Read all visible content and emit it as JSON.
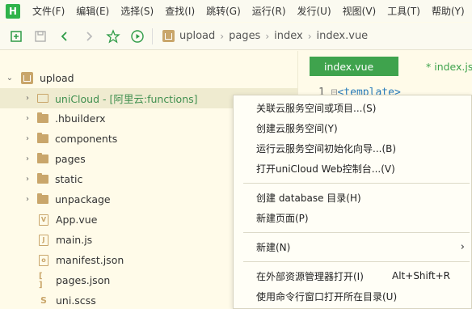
{
  "menubar": {
    "logo": "H",
    "items": [
      "文件(F)",
      "编辑(E)",
      "选择(S)",
      "查找(I)",
      "跳转(G)",
      "运行(R)",
      "发行(U)",
      "视图(V)",
      "工具(T)",
      "帮助(Y)"
    ]
  },
  "toolbar": {
    "breadcrumb": [
      "upload",
      "pages",
      "index",
      "index.vue"
    ]
  },
  "tree": {
    "project": "upload",
    "rows": [
      {
        "label": "uniCloud - [阿里云:functions]",
        "kind": "cloud",
        "expandable": true
      },
      {
        "label": ".hbuilderx",
        "kind": "folder",
        "expandable": true
      },
      {
        "label": "components",
        "kind": "folder",
        "expandable": true
      },
      {
        "label": "pages",
        "kind": "folder",
        "expandable": true
      },
      {
        "label": "static",
        "kind": "folder",
        "expandable": true
      },
      {
        "label": "unpackage",
        "kind": "folder",
        "expandable": true
      },
      {
        "label": "App.vue",
        "kind": "file",
        "glyph": "V"
      },
      {
        "label": "main.js",
        "kind": "file",
        "glyph": "J"
      },
      {
        "label": "manifest.json",
        "kind": "file",
        "glyph": "o"
      },
      {
        "label": "pages.json",
        "kind": "file",
        "glyph": "[ ]"
      },
      {
        "label": "uni.scss",
        "kind": "file",
        "glyph": "S"
      }
    ]
  },
  "editor": {
    "active_tab": "index.vue",
    "inactive_tab": "* index.js",
    "line_number": "1",
    "code_open": "<",
    "code_tag": "template",
    "code_close": ">"
  },
  "context_menu": {
    "group1": [
      "关联云服务空间或项目...(S)",
      "创建云服务空间(Y)",
      "运行云服务空间初始化向导...(B)",
      "打开uniCloud Web控制台...(V)"
    ],
    "group2": [
      "创建 database 目录(H)",
      "新建页面(P)"
    ],
    "group3": [
      "新建(N)"
    ],
    "group4": [
      {
        "label": "在外部资源管理器打开(I)",
        "shortcut": "Alt+Shift+R"
      },
      {
        "label": "使用命令行窗口打开所在目录(U)",
        "shortcut": ""
      }
    ],
    "submenu_arrow": "›"
  },
  "colors": {
    "accent_green": "#3fa34d",
    "folder_tan": "#c9a66b",
    "background": "#fffbe9"
  }
}
